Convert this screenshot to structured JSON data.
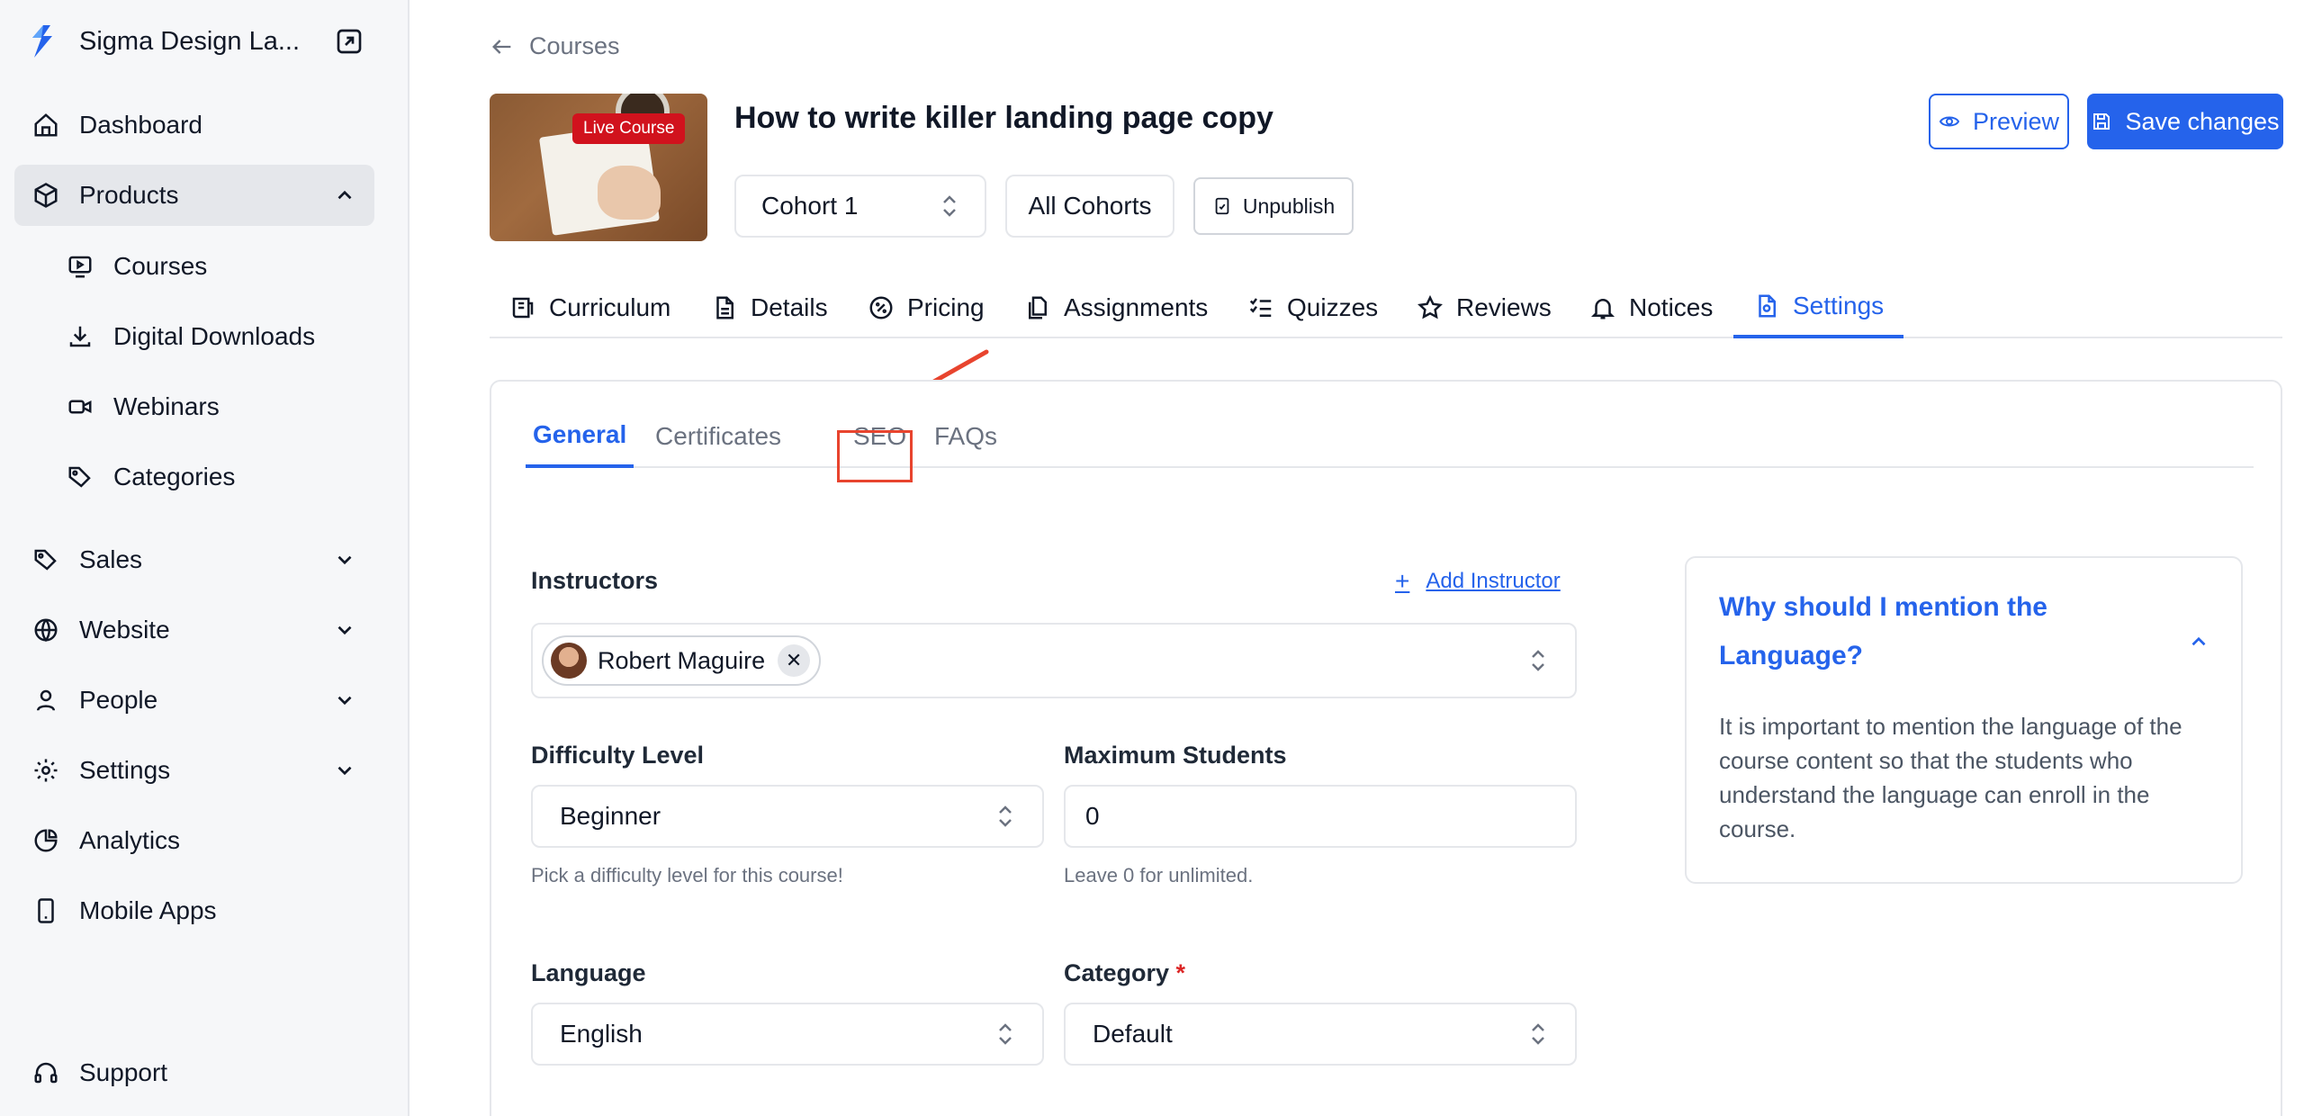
{
  "sidebar": {
    "brand": "Sigma Design La...",
    "nav": [
      {
        "label": "Dashboard",
        "icon": "home-icon"
      },
      {
        "label": "Products",
        "icon": "box-icon"
      },
      {
        "label": "Sales",
        "icon": "tag-icon"
      },
      {
        "label": "Website",
        "icon": "globe-icon"
      },
      {
        "label": "People",
        "icon": "user-icon"
      },
      {
        "label": "Settings",
        "icon": "gear-icon"
      },
      {
        "label": "Analytics",
        "icon": "pie-chart-icon"
      },
      {
        "label": "Mobile Apps",
        "icon": "mobile-icon"
      }
    ],
    "products_sub": [
      {
        "label": "Courses",
        "icon": "monitor-icon"
      },
      {
        "label": "Digital Downloads",
        "icon": "download-icon"
      },
      {
        "label": "Webinars",
        "icon": "video-icon"
      },
      {
        "label": "Categories",
        "icon": "tags-icon"
      }
    ],
    "support": "Support"
  },
  "header": {
    "back_label": "Courses",
    "course_title": "How to write killer landing page copy",
    "badge": "Live Course",
    "cohort_select": "Cohort 1",
    "all_cohorts": "All Cohorts",
    "unpublish": "Unpublish",
    "preview": "Preview",
    "save": "Save changes"
  },
  "tabs": [
    "Curriculum",
    "Details",
    "Pricing",
    "Assignments",
    "Quizzes",
    "Reviews",
    "Notices",
    "Settings"
  ],
  "subtabs": [
    "General",
    "Certificates",
    "SEO",
    "FAQs"
  ],
  "form": {
    "instructors_label": "Instructors",
    "add_instructor": "Add Instructor",
    "instructor_name": "Robert Maguire",
    "difficulty_label": "Difficulty Level",
    "difficulty_value": "Beginner",
    "difficulty_help": "Pick a difficulty level for this course!",
    "max_label": "Maximum Students",
    "max_value": "0",
    "max_help": "Leave 0 for unlimited.",
    "language_label": "Language",
    "language_value": "English",
    "category_label": "Category",
    "category_required": "*",
    "category_value": "Default"
  },
  "info": {
    "title": "Why should I mention the Language?",
    "body": "It is important to mention the language of the course content so that the students who understand the language can enroll in the course."
  },
  "colors": {
    "accent": "#2563eb",
    "highlight": "#e8442e",
    "badge": "#d1121d"
  }
}
